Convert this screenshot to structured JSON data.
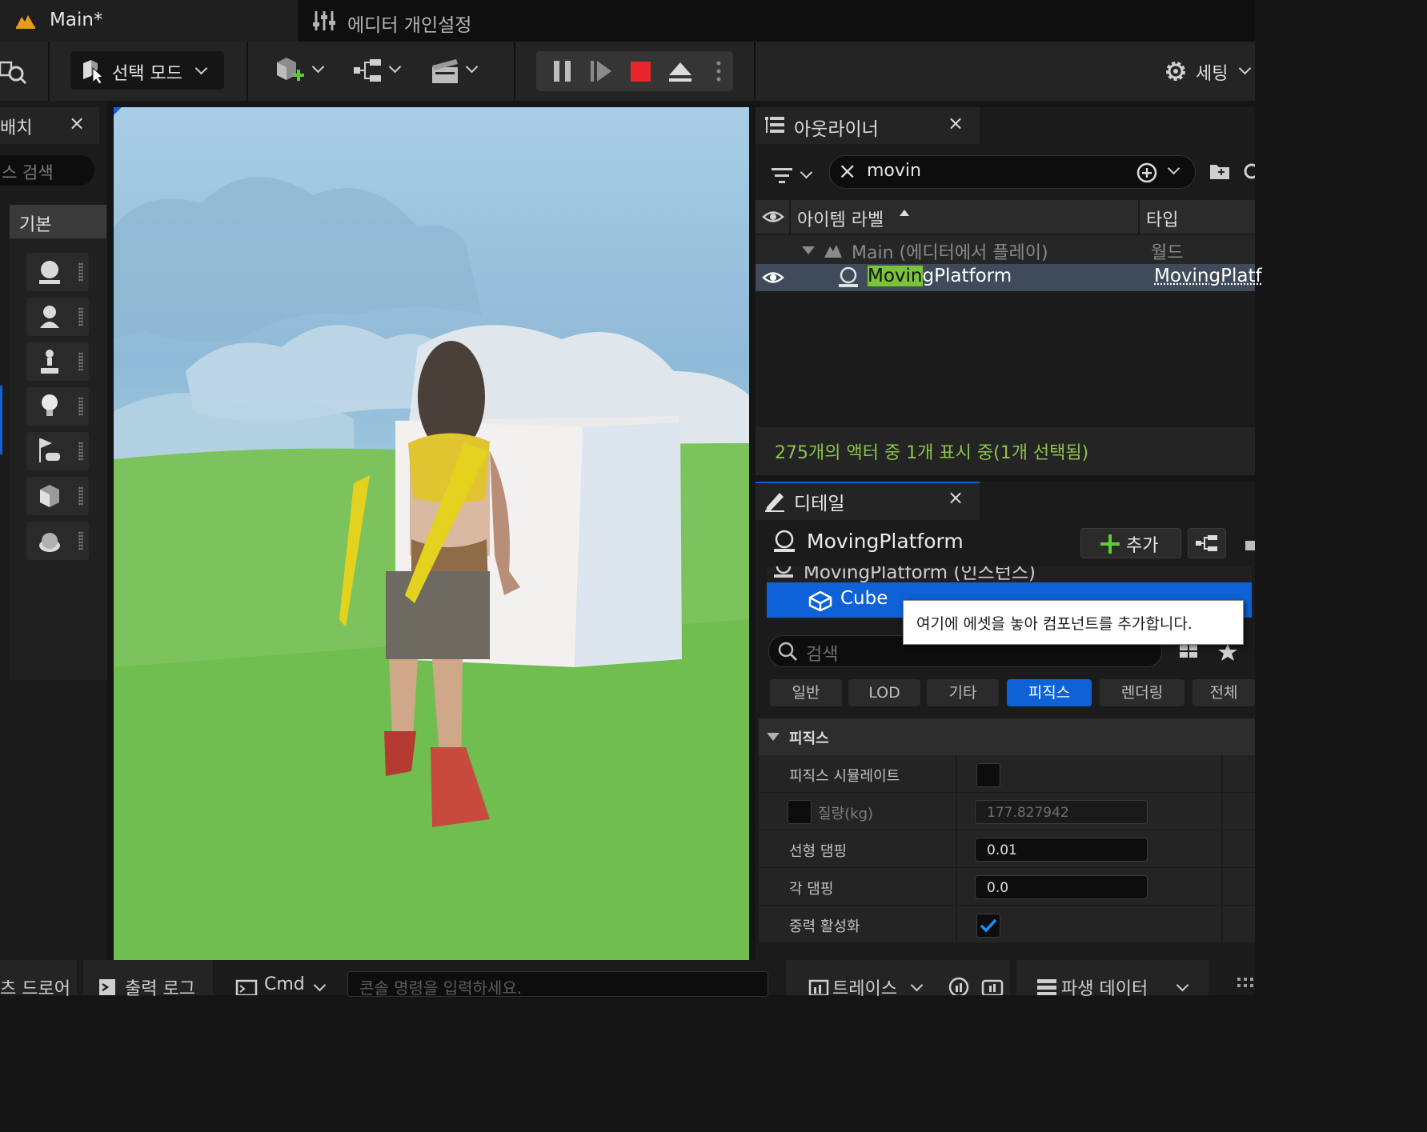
{
  "tabs": {
    "main": "Main*",
    "prefs": "에디터 개인설정"
  },
  "toolbar": {
    "select_mode": "선택 모드",
    "settings": "세팅"
  },
  "place_panel": {
    "title": "배치",
    "search_placeholder": "스 검색",
    "category": "기본"
  },
  "outliner": {
    "title": "아웃라이너",
    "search_value": "movin",
    "col_label": "아이템 라벨",
    "col_type": "타입",
    "world_row": {
      "label": "Main (에디터에서 플레이)",
      "type": "월드"
    },
    "selected_row": {
      "match": "Movin",
      "rest": "gPlatform",
      "type": "MovingPlatf"
    },
    "status": "275개의 액터 중 1개 표시 중(1개 선택됨)"
  },
  "details": {
    "title": "디테일",
    "actor_name": "MovingPlatform",
    "add_button": "추가",
    "component_partial": "MovingPlatform (인스턴스)",
    "component_cube": "Cube",
    "tooltip": "여기에 에셋을 놓아 컴포넌트를 추가합니다.",
    "search_placeholder": "검색",
    "category_tabs": [
      "일반",
      "LOD",
      "기타",
      "피직스",
      "렌더링",
      "전체"
    ],
    "active_tab": "피직스",
    "section": "피직스",
    "props": {
      "simulate": "피직스 시뮬레이트",
      "mass_label": "질량(kg)",
      "mass_value": "177.827942",
      "linear_damping_label": "선형 댐핑",
      "linear_damping_value": "0.01",
      "angular_damping_label": "각 댐핑",
      "angular_damping_value": "0.0",
      "gravity_label": "중력 활성화"
    }
  },
  "bottom": {
    "content_drawer": "츠 드로어",
    "output_log": "출력 로그",
    "cmd": "Cmd",
    "console_placeholder": "콘솔 명령을 입력하세요.",
    "trace": "트레이스",
    "derived_data": "파생 데이터"
  },
  "colors": {
    "accent_blue": "#0e62d6",
    "highlight": "#7bc43a",
    "status_green": "#8bc34a",
    "play_stop": "#e8262c"
  }
}
